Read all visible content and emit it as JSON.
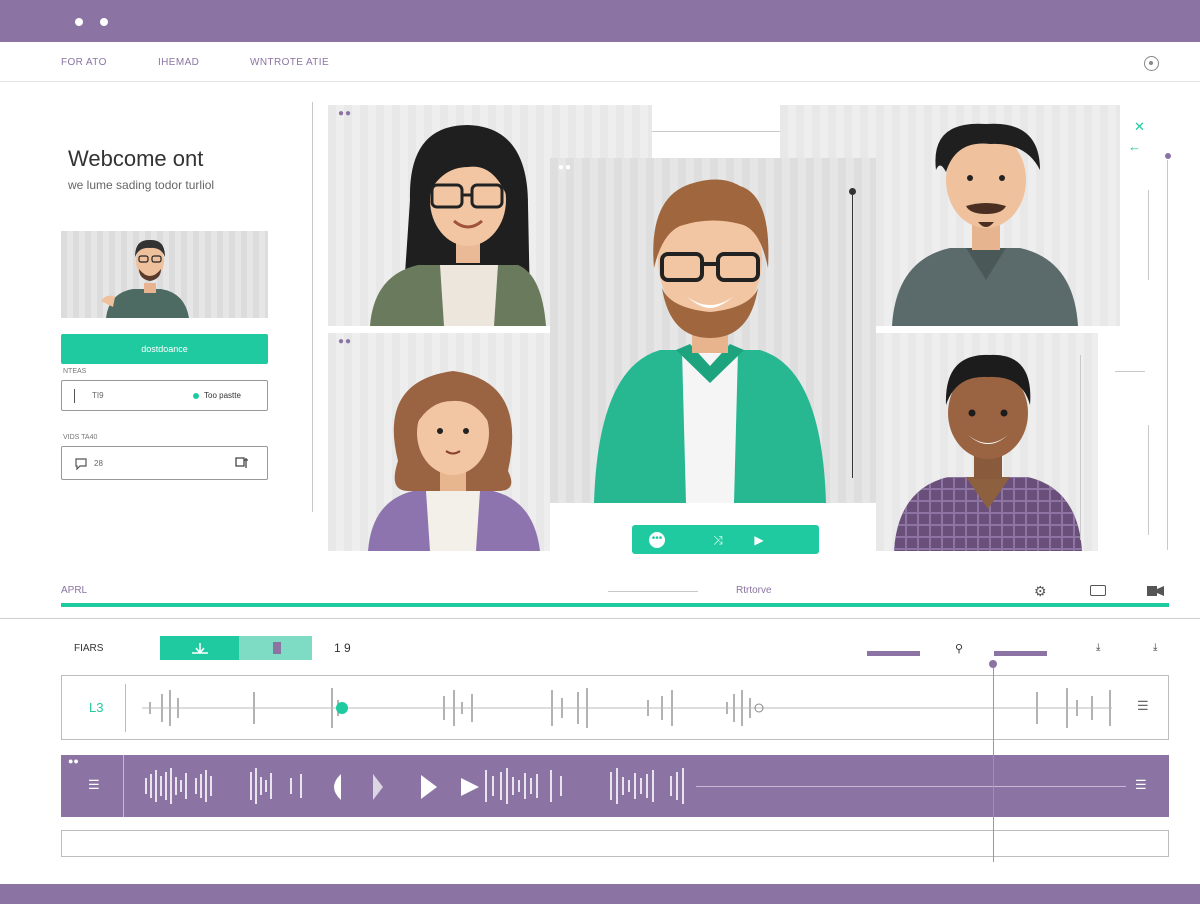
{
  "window": {
    "accent": "#8b74a3",
    "teal": "#1fcaa0"
  },
  "nav": {
    "links": [
      "FOR ATO",
      "IHEMAD",
      "WNTROTE ATIE"
    ]
  },
  "sidebar": {
    "welcome_title": "Webcome ont",
    "welcome_subtitle": "we lume sading todor turliol",
    "action_label": "dostdoance",
    "field1": {
      "label": "NTEAS",
      "value": "TI9",
      "badge": "Too pastte"
    },
    "field2": {
      "label": "VIDS TA40",
      "value": "28"
    }
  },
  "toolbar": {
    "left_label": "APRL",
    "center_label": "Rtrtorve"
  },
  "timeline": {
    "tracks_label": "FIARS",
    "time_readout": "1 9",
    "track1_label": "L3"
  },
  "icons": [
    "settings-icon",
    "close-icon",
    "back-arrow-icon",
    "chat-icon",
    "shuffle-icon",
    "play-icon",
    "gear-icon",
    "window-icon",
    "video-icon",
    "list-icon",
    "menu-icon"
  ]
}
